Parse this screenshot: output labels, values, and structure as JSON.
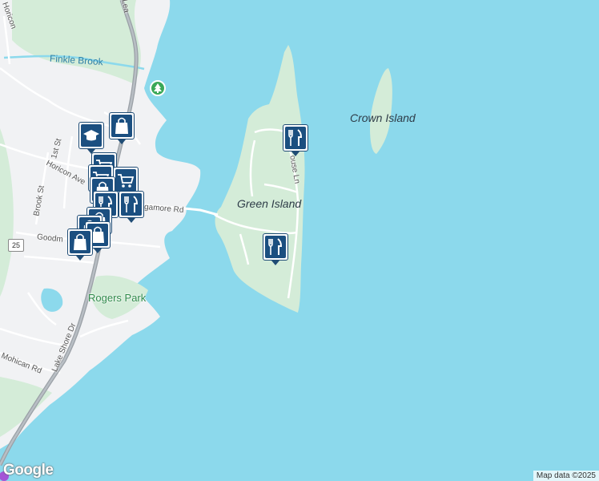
{
  "map": {
    "labels": {
      "green_island": "Green Island",
      "crown_island": "Crown Island",
      "finkle_brook": "Finkle Brook",
      "rogers_park": "Rogers Park",
      "sagamore_rd": "gamore Rd",
      "horicon_ave": "Horicon Ave",
      "brook_st": "Brook St",
      "first_st": "1st St",
      "goodman": "Goodm",
      "lake_shore_dr": "Lake Shore Dr",
      "mohican_rd": "Mohican Rd",
      "house_ln": "ouse Ln",
      "horicon_top": "Horicon",
      "road_top": "Lea"
    },
    "route_shield": "25",
    "markers": [
      {
        "icon": "education-icon",
        "label": "school"
      },
      {
        "icon": "shopping-bag-icon",
        "label": "shopping"
      },
      {
        "icon": "grocery-cart-icon",
        "label": "grocery"
      },
      {
        "icon": "restaurant-icon",
        "label": "restaurant"
      },
      {
        "icon": "shopping-bag-icon",
        "label": "shopping"
      },
      {
        "icon": "restaurant-icon",
        "label": "restaurant"
      },
      {
        "icon": "restaurant-icon",
        "label": "restaurant"
      }
    ],
    "colors": {
      "water": "#8cd9ec",
      "land": "#f1f2f4",
      "park": "#d4ecd8",
      "marker": "#1b4f80"
    },
    "logo": "Google",
    "attribution": "Map data ©2025"
  }
}
